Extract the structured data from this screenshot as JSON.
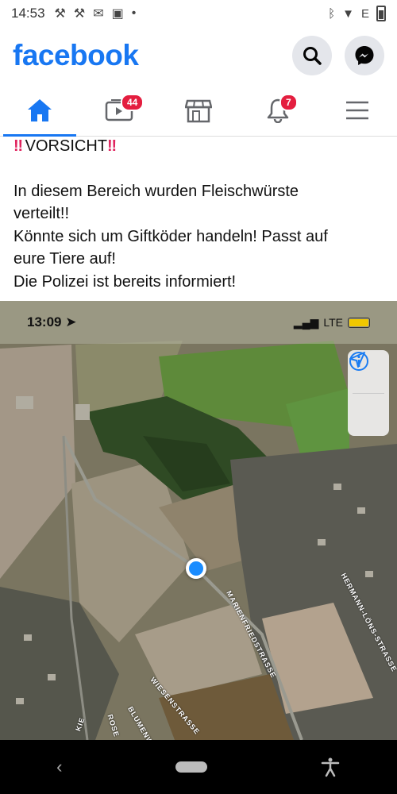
{
  "status_bar": {
    "time": "14:53",
    "network": "E"
  },
  "header": {
    "logo": "facebook"
  },
  "tabs": [
    {
      "name": "home",
      "badge": ""
    },
    {
      "name": "watch",
      "badge": "44"
    },
    {
      "name": "marketplace",
      "badge": ""
    },
    {
      "name": "notifications",
      "badge": "7"
    },
    {
      "name": "menu",
      "badge": ""
    }
  ],
  "post": {
    "heading": "VORSICHT",
    "heading_emoji": "‼",
    "lines": [
      "In diesem Bereich wurden Fleischwürste",
      "verteilt!!",
      "Könnte sich um Giftköder handeln! Passt auf",
      "eure Tiere auf!",
      "Die Polizei ist bereits informiert!"
    ]
  },
  "map": {
    "time": "13:09",
    "network": "LTE",
    "streets": {
      "marienfried": "MARIENFRIEDSTRASSE",
      "hermann": "HERMANN-LÖNS-STRASSE",
      "wiesen": "WIESENSTRASSE",
      "blumen": "BLUMENW",
      "rosen": "ROSE",
      "kie": "KIE"
    }
  },
  "colors": {
    "brand": "#1877f2",
    "badge": "#e41e3f"
  }
}
